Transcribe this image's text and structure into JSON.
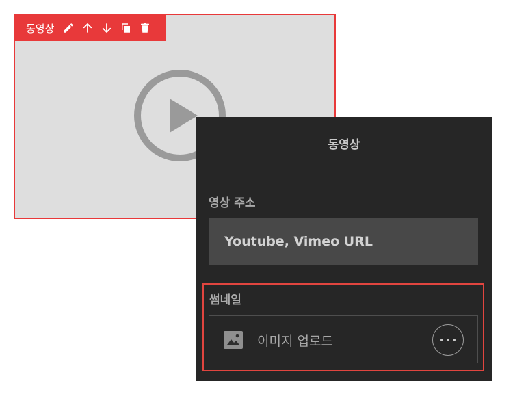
{
  "video_block": {
    "toolbar": {
      "label": "동영상",
      "icons": [
        "pencil-icon",
        "arrow-up-icon",
        "arrow-down-icon",
        "copy-icon",
        "trash-icon"
      ]
    },
    "play_icon": "play-icon"
  },
  "panel": {
    "title": "동영상",
    "video_url": {
      "label": "영상 주소",
      "placeholder": "Youtube, Vimeo URL"
    },
    "thumbnail": {
      "label": "썸네일",
      "upload_text": "이미지 업로드",
      "upload_icon": "image-icon",
      "more_icon": "more-icon"
    }
  },
  "colors": {
    "accent_red": "#e8393a",
    "panel_bg": "#262626",
    "video_bg": "#dedede"
  }
}
